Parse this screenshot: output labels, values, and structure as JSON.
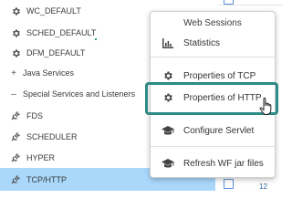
{
  "tree": {
    "items": [
      {
        "label": "WC_DEFAULT",
        "icon": "gear-icon"
      },
      {
        "label": "SCHED_DEFAULT",
        "icon": "gear-icon"
      },
      {
        "label": "DFM_DEFAULT",
        "icon": "gear-icon"
      },
      {
        "label": "Java Services",
        "icon": "plus-icon",
        "sign": "+"
      },
      {
        "label": "Special Services and Listeners",
        "icon": "minus-icon",
        "sign": "–"
      },
      {
        "label": "FDS",
        "icon": "plug-icon"
      },
      {
        "label": "SCHEDULER",
        "icon": "plug-icon"
      },
      {
        "label": "HYPER",
        "icon": "plug-icon"
      },
      {
        "label": "TCP/HTTP",
        "icon": "plug-icon",
        "selected": true
      }
    ]
  },
  "menu": {
    "header": "Web Sessions",
    "items": [
      {
        "label": "Statistics",
        "icon": "bar-chart-icon"
      },
      {
        "label": "Properties of TCP",
        "icon": "gear-icon"
      },
      {
        "label": "Properties of HTTP",
        "icon": "gear-icon",
        "highlighted": true
      },
      {
        "label": "Configure Servlet",
        "icon": "graduation-cap-icon"
      },
      {
        "label": "Refresh WF jar files",
        "icon": "graduation-cap-icon"
      }
    ]
  },
  "background": {
    "right_text": "12"
  },
  "colors": {
    "selected_row": "#aad8fb",
    "highlight_border": "#2e8a85",
    "checkbox_border": "#5b8fd6"
  }
}
